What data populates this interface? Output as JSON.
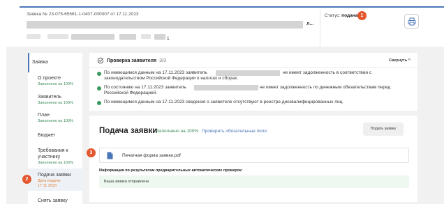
{
  "header": {
    "app_number": "Заявка № 23-075-65561-1-0407-000007 от 17.11.2023",
    "title_suffix": "л...",
    "line2_suffix": "1",
    "status_label": "Статус:",
    "status_value": "подана",
    "print_icon": "printer-icon"
  },
  "markers": [
    "1",
    "2",
    "3"
  ],
  "sidebar": {
    "items": [
      {
        "label": "Заявка",
        "sub": ""
      },
      {
        "label": "О проекте",
        "sub": "Заполнено на 100%"
      },
      {
        "label": "Заявитель",
        "sub": "Заполнено на 100%"
      },
      {
        "label": "План",
        "sub": "Заполнено на 100%"
      },
      {
        "label": "Бюджет",
        "sub": ""
      },
      {
        "label": "Требования к участнику",
        "sub": "Заполнено на 100%"
      },
      {
        "label": "Подача заявки",
        "sub": "Дата подачи: 17.11.2023"
      },
      {
        "label": "Снять заявку",
        "sub": ""
      }
    ]
  },
  "check": {
    "title": "Проверка заявителя",
    "count": "3/3",
    "collapse_label": "Свернуть",
    "rows": [
      {
        "a": "По имеющимся данным на 17.11.2023 заявитель",
        "b": "не имеет задолженность в соответствии с",
        "c": "законодательством Российской Федерации о налогах и сборах."
      },
      {
        "a": "По состоянию на 17.11.2023 заявитель",
        "b": "не имеет задолженность по денежным обязательствам перед",
        "c": "Российской Федерацией."
      },
      {
        "a": "По имеющимся данным на 17.11.2023 сведения о заявителе отсутствуют в реестре дисквалифицированных лиц."
      }
    ]
  },
  "submission": {
    "title": "Подача заявки",
    "filled": "Заполнено на 100%",
    "check_link": "Проверить обязательные поля",
    "submit_button": "Подать заявку",
    "file_label": "Печатная форма заявки.pdf",
    "info_label": "Информация по результатам предварительных автоматических проверок:",
    "info_text": "Ваша заявка отправлена"
  },
  "colors": {
    "accent": "#4a76b8",
    "success": "#3a8a57",
    "marker": "#e4572e",
    "date": "#e07a2c"
  }
}
